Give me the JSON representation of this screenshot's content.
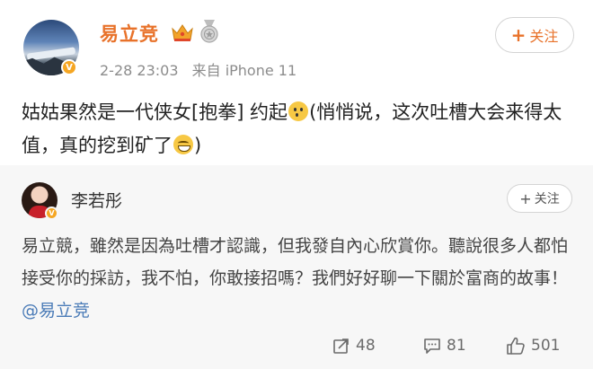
{
  "post": {
    "username": "易立竞",
    "timestamp": "2-28 23:03",
    "source": "来自 iPhone 11",
    "follow_label": "关注",
    "text_part1": "姑姑果然是一代侠女[抱拳] 约起",
    "text_part2": "(悄悄说，这次吐槽大会来得太值，真的挖到矿了",
    "emoji_1": "fear-emoji",
    "emoji_2": "grin-emoji"
  },
  "repost": {
    "username": "李若彤",
    "follow_label": "关注",
    "text": "易立競，雖然是因為吐槽才認識，但我發自內心欣賞你。聽說很多人都怕接受你的採訪，我不怕，你敢接招嗎？我們好好聊一下關於富商的故事！",
    "mention": "@易立竞",
    "actions": {
      "forward_count": "48",
      "comment_count": "81",
      "like_count": "501"
    }
  },
  "colors": {
    "username_orange": "#e8722a",
    "vip_badge": "#f5a623",
    "mention_blue": "#4a7bb7",
    "repost_bg": "#f7f7f7"
  }
}
